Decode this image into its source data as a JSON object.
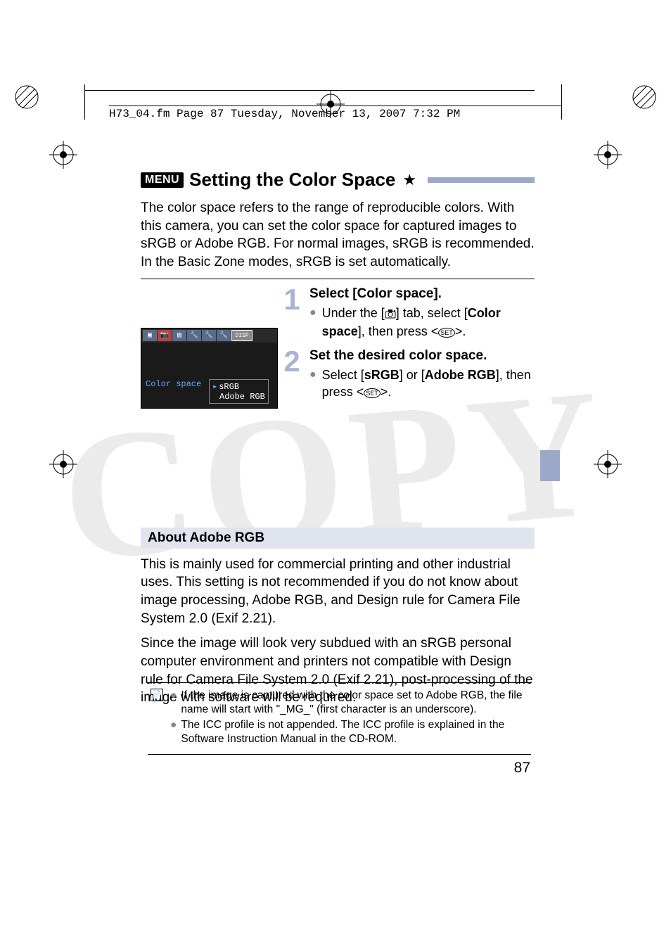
{
  "header": {
    "running": "H73_04.fm  Page 87  Tuesday, November 13, 2007  7:32 PM"
  },
  "title": {
    "menu_badge": "MENU",
    "text": "Setting the Color Space",
    "star": "★"
  },
  "intro": "The color space refers to the range of reproducible colors. With this camera, you can set the color space for captured images to sRGB or Adobe RGB. For normal images, sRGB is recommended. In the Basic Zone modes, sRGB is set automatically.",
  "steps": [
    {
      "num": "1",
      "title": "Select [Color space].",
      "bullet_pre": "Under the [",
      "bullet_mid": "] tab, select [",
      "bullet_bold": "Color space",
      "bullet_post": "], then press <",
      "bullet_end": ">."
    },
    {
      "num": "2",
      "title": "Set the desired color space.",
      "bullet_pre": "Select [",
      "opt1": "sRGB",
      "mid": "] or [",
      "opt2": "Adobe RGB",
      "post": "], then press <",
      "end": ">."
    }
  ],
  "screenshot": {
    "tabs_disp": "DISP",
    "label": "Color space",
    "options": [
      "sRGB",
      "Adobe RGB"
    ],
    "selected": 0
  },
  "subhead": "About Adobe RGB",
  "about": {
    "p1": "This is mainly used for commercial printing and other industrial uses. This setting is not recommended if you do not know about image processing, Adobe RGB, and Design rule for Camera File System 2.0 (Exif 2.21).",
    "p2": "Since the image will look very subdued with an sRGB personal computer environment and printers not compatible with Design rule for Camera File System 2.0 (Exif 2.21), post-processing of the image with software will be required."
  },
  "notes": [
    "If the image is captured with the color space set to Adobe RGB, the file name will start with \"_MG_\" (first character is an underscore).",
    "The ICC profile is not appended. The ICC profile is explained in the Software Instruction Manual in the CD-ROM."
  ],
  "page_number": "87"
}
